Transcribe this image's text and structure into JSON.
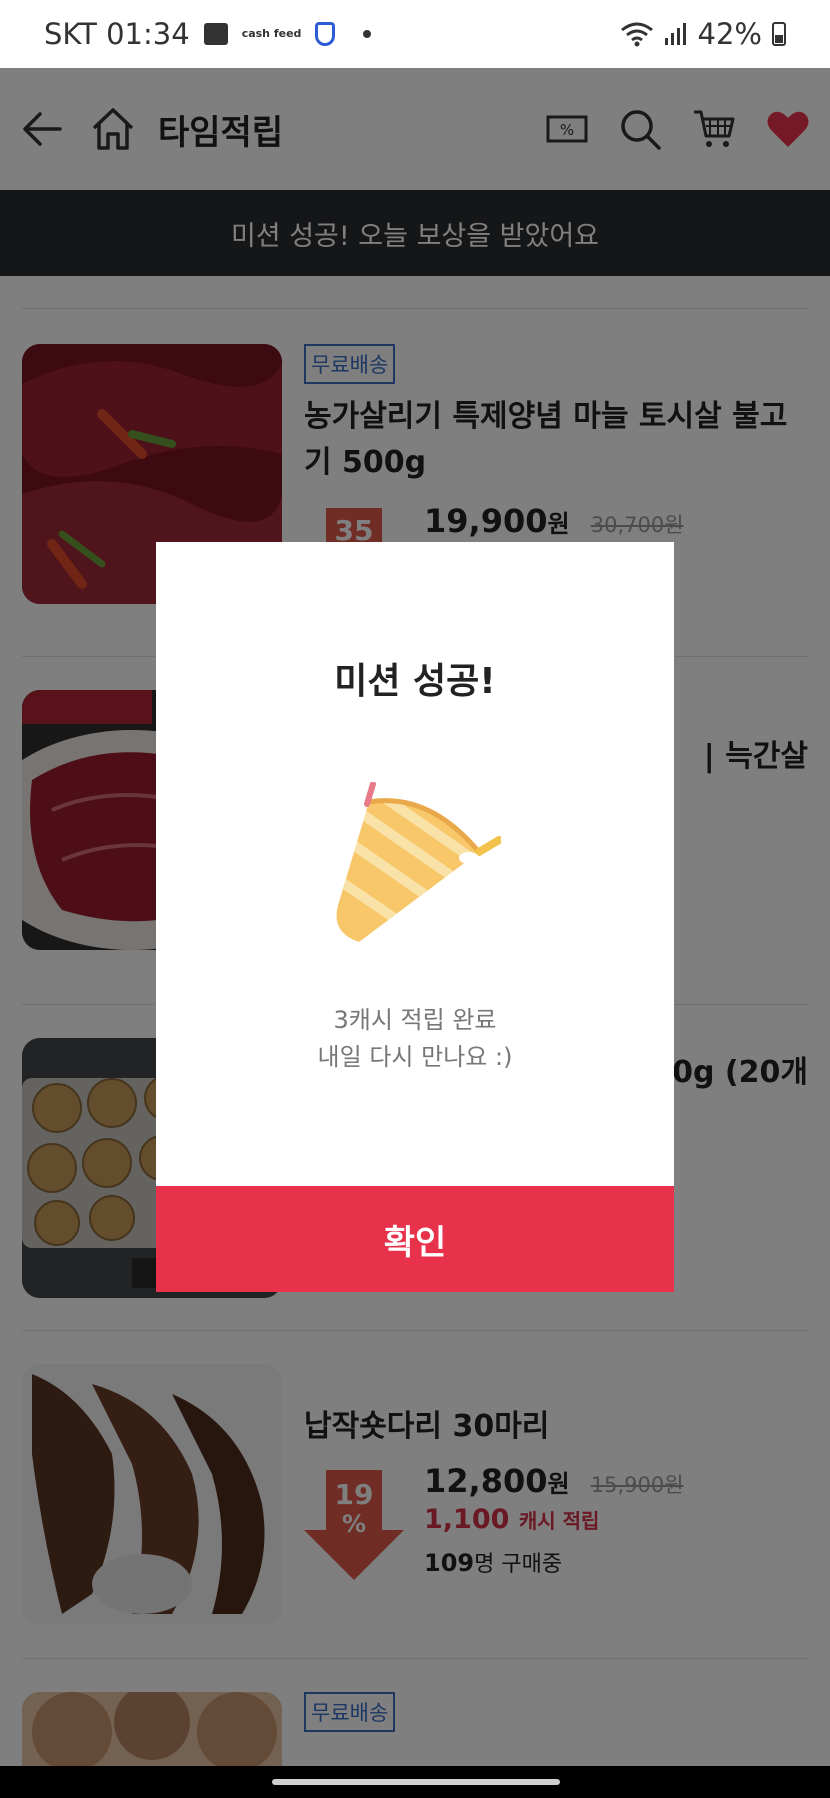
{
  "status_bar": {
    "carrier_time": "SKT 01:34",
    "cash_icon_text": "cash feed",
    "battery": "42%"
  },
  "header": {
    "title": "타임적립"
  },
  "notice": {
    "text": "미션 성공! 오늘 보상을 받았어요"
  },
  "products": [
    {
      "badge": "무료배송",
      "name": "농가살리기 특제양념 마늘 토시살 불고기 500g",
      "discount": "35",
      "price": "19,900",
      "currency": "원",
      "original_price": "30,700원"
    },
    {
      "name_partial": "| 늑간살"
    },
    {
      "name_partial": "0g (20개"
    },
    {
      "name": "납작숏다리 30마리",
      "discount": "19",
      "discount_unit": "%",
      "price": "12,800",
      "currency": "원",
      "original_price": "15,900원",
      "cash_amount": "1,100",
      "cash_label": "캐시 적립",
      "buyers_count": "109",
      "buyers_label": "명 구매중"
    },
    {
      "badge": "무료배송"
    }
  ],
  "modal": {
    "title": "미션 성공!",
    "line1": "3캐시 적립 완료",
    "line2": "내일 다시 만나요 :)",
    "confirm": "확인"
  },
  "colors": {
    "accent": "#e8324b",
    "notice_bg": "#2b2d30",
    "badge_blue": "#3a6fc4",
    "discount_red": "#e05a4a"
  }
}
